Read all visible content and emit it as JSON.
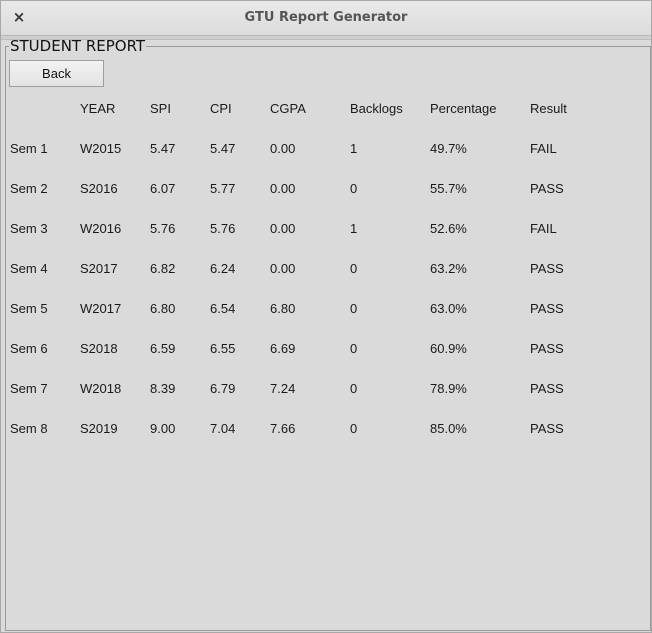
{
  "window": {
    "title": "GTU Report Generator",
    "close_glyph": "×"
  },
  "report": {
    "group_title": "STUDENT REPORT",
    "back_label": "Back",
    "columns": [
      "",
      "YEAR",
      "SPI",
      "CPI",
      "CGPA",
      "Backlogs",
      "Percentage",
      "Result"
    ],
    "rows": [
      [
        "Sem 1",
        "W2015",
        "5.47",
        "5.47",
        "0.00",
        "1",
        "49.7%",
        "FAIL"
      ],
      [
        "Sem 2",
        "S2016",
        "6.07",
        "5.77",
        "0.00",
        "0",
        "55.7%",
        "PASS"
      ],
      [
        "Sem 3",
        "W2016",
        "5.76",
        "5.76",
        "0.00",
        "1",
        "52.6%",
        "FAIL"
      ],
      [
        "Sem 4",
        "S2017",
        "6.82",
        "6.24",
        "0.00",
        "0",
        "63.2%",
        "PASS"
      ],
      [
        "Sem 5",
        "W2017",
        "6.80",
        "6.54",
        "6.80",
        "0",
        "63.0%",
        "PASS"
      ],
      [
        "Sem 6",
        "S2018",
        "6.59",
        "6.55",
        "6.69",
        "0",
        "60.9%",
        "PASS"
      ],
      [
        "Sem 7",
        "W2018",
        "8.39",
        "6.79",
        "7.24",
        "0",
        "78.9%",
        "PASS"
      ],
      [
        "Sem 8",
        "S2019",
        "9.00",
        "7.04",
        "7.66",
        "0",
        "85.0%",
        "PASS"
      ]
    ]
  }
}
